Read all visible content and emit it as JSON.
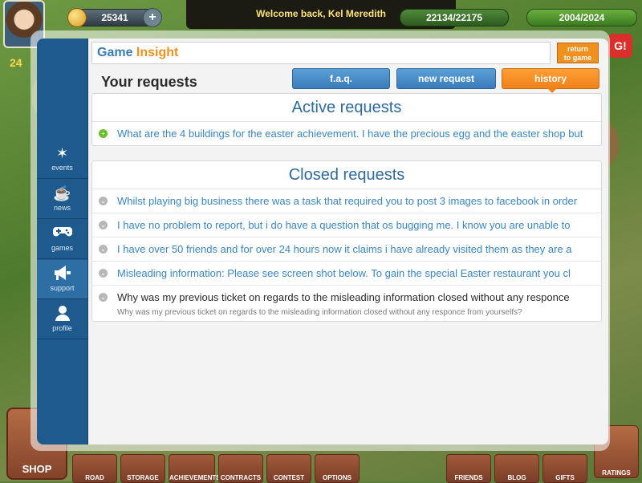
{
  "hud": {
    "coins": "25341",
    "welcome": "Welcome back, Kel Meredith",
    "population": "22134/22175",
    "energy": "2004/2024",
    "level": "24"
  },
  "toolbar": {
    "shop": "SHOP",
    "items": [
      "ROAD",
      "STORAGE",
      "ACHIEVEMENTS",
      "CONTRACTS",
      "CONTEST",
      "OPTIONS",
      "FRIENDS",
      "BLOG",
      "GIFTS",
      "RATINGS"
    ]
  },
  "sidebar": {
    "items": [
      {
        "label": "events",
        "icon": "stars-icon"
      },
      {
        "label": "news",
        "icon": "coffee-icon"
      },
      {
        "label": "games",
        "icon": "gamepad-icon"
      },
      {
        "label": "support",
        "icon": "megaphone-icon"
      },
      {
        "label": "profile",
        "icon": "person-icon"
      }
    ],
    "active": "support"
  },
  "header": {
    "logo_part1": "Game",
    "logo_part2": "Insight",
    "return_line1": "return",
    "return_line2": "to game",
    "title": "Your requests"
  },
  "tabs": {
    "faq": "f.a.q.",
    "new_request": "new request",
    "history": "history"
  },
  "active_requests": {
    "heading": "Active requests",
    "items": [
      "What are the 4 buildings for the easter achievement. I have the precious egg and the easter shop but"
    ]
  },
  "closed_requests": {
    "heading": "Closed requests",
    "items": [
      "Whilst playing big business there was a task that required you to post 3 images to facebook in order",
      "I have no problem to report, but i do have a question that os bugging me. I know you are unable to",
      "I have over 50 friends and for over 24 hours now it claims i have already visited them as they are a",
      "Misleading information: Please see screen shot below. To gain the special Easter restaurant you cl",
      "Why was my previous ticket on regards to the misleading information closed without any responce"
    ],
    "expanded_detail": "Why was my previous ticket on regards to the misleading information closed without any responce from yourselfs?"
  },
  "colors": {
    "sidebar": "#1f5a8e",
    "tab_blue": "#3a7cba",
    "tab_orange": "#f0801a",
    "link": "#3a86c2"
  }
}
